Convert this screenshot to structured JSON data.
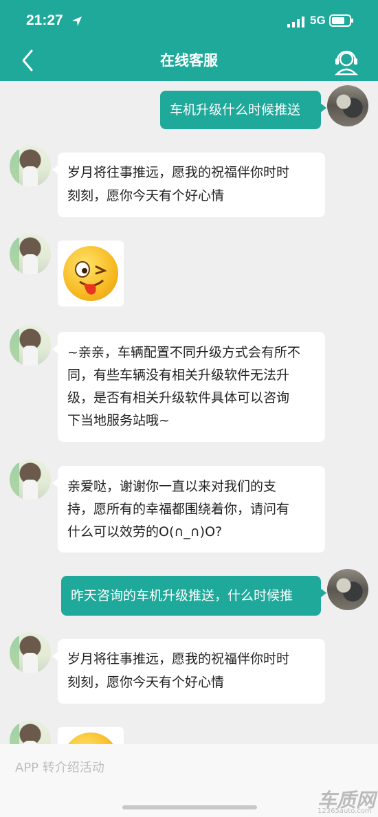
{
  "status_bar": {
    "time": "21:27",
    "network": "5G"
  },
  "header": {
    "title": "在线客服"
  },
  "messages": [
    {
      "from": "user",
      "text": "车机升级什么时候推送"
    },
    {
      "from": "agent",
      "lines": [
        "岁月将往事推远，愿我的祝福伴你时时",
        "刻刻，愿你今天有个好心情"
      ]
    },
    {
      "from": "agent",
      "type": "emoji",
      "icon": "wink-tongue-emoji-icon"
    },
    {
      "from": "agent",
      "lines": [
        "~亲亲，车辆配置不同升级方式会有所不",
        "同，有些车辆没有相关升级软件无法升",
        "级，是否有相关升级软件具体可以咨询",
        "下当地服务站哦~"
      ]
    },
    {
      "from": "agent",
      "lines": [
        "亲爱哒，谢谢你一直以来对我们的支",
        "持，愿所有的幸福都围绕着你，请问有",
        "什么可以效劳的O(∩_∩)O?"
      ]
    },
    {
      "from": "user",
      "text": "昨天咨询的车机升级推送，什么时候推"
    },
    {
      "from": "agent",
      "lines": [
        "岁月将往事推远，愿我的祝福伴你时时",
        "刻刻，愿你今天有个好心情"
      ]
    }
  ],
  "input": {
    "placeholder": "APP 转介绍活动"
  },
  "watermark": {
    "brand": "车质网",
    "url": "12365auto.com"
  },
  "colors": {
    "accent": "#1fa99a",
    "background": "#efefef"
  }
}
